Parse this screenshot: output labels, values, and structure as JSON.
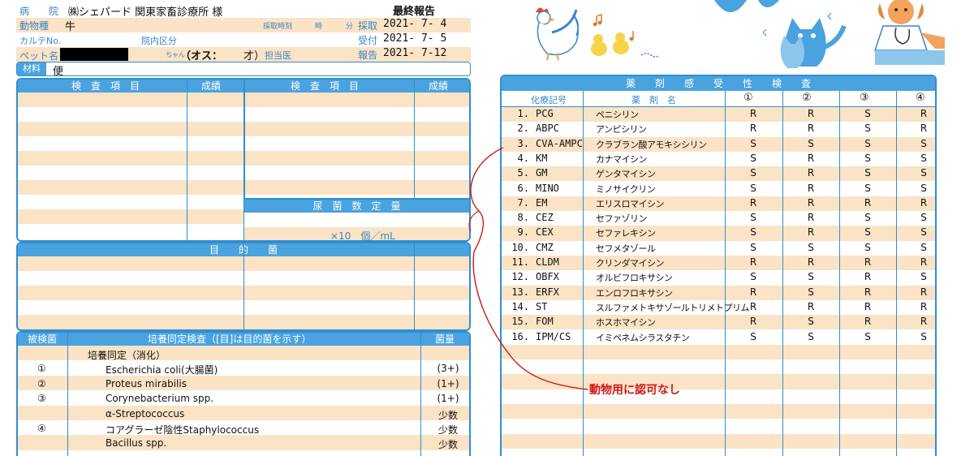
{
  "header": {
    "hospital_label": "病　　院",
    "hospital_value": "㈱シェパード 関東家畜診療所 様",
    "report_title": "最終報告",
    "animal_label": "動物種",
    "animal_value": "牛",
    "collection_time_label": "採取時刻",
    "hour_label": "時",
    "minute_label": "分",
    "collect_label": "採取",
    "collect_date": "2021- 7- 4",
    "chart_label": "カルテNo.",
    "ward_label": "院内区分",
    "receive_label": "受付",
    "receive_date": "2021- 7- 5",
    "pet_label": "ペット名",
    "age_label": "ちゃん",
    "sex_value": "（オス：",
    "age_unit": "才）",
    "staff_label": "担当医",
    "report_label": "報告",
    "report_date": "2021- 7-12",
    "material_label": "材料",
    "material_value": "便"
  },
  "exam_box": {
    "col1": "検　査　項　目",
    "col2": "成績",
    "col3": "検　査　項　目",
    "col4": "成績",
    "urine_title": "尿　菌　数　定　量",
    "urine_unit": "×10　個／mL"
  },
  "target_box": {
    "title": "目　　的　　菌"
  },
  "culture": {
    "col1": "被検菌",
    "col2": "培養同定検査（[目]は目的菌を示す）",
    "col3": "菌量",
    "rows": [
      {
        "mark": "",
        "name": "培養同定（消化）",
        "amount": ""
      },
      {
        "mark": "①",
        "name": "Escherichia coli(大腸菌)",
        "amount": "(3+)"
      },
      {
        "mark": "②",
        "name": "Proteus mirabilis",
        "amount": "(1+)"
      },
      {
        "mark": "③",
        "name": "Corynebacterium spp.",
        "amount": "(1+)"
      },
      {
        "mark": "",
        "name": "α-Streptococcus",
        "amount": "少数"
      },
      {
        "mark": "④",
        "name": "コアグラーゼ陰性Staphylococcus",
        "amount": "少数"
      },
      {
        "mark": "",
        "name": "Bacillus spp.",
        "amount": "少数"
      }
    ]
  },
  "drug_table": {
    "title": "薬　　剤　　感　　受　　性　　検　　査",
    "col_code": "化療記号",
    "col_name": "薬　剤　名",
    "col_1": "①",
    "col_2": "②",
    "col_3": "③",
    "col_4": "④",
    "rows": [
      {
        "no": "1.",
        "code": "PCG",
        "name": "ペニシリン",
        "r1": "R",
        "r2": "R",
        "r3": "S",
        "r4": "R"
      },
      {
        "no": "2.",
        "code": "ABPC",
        "name": "アンピシリン",
        "r1": "R",
        "r2": "R",
        "r3": "S",
        "r4": "R"
      },
      {
        "no": "3.",
        "code": "CVA-AMPC",
        "name": "クラブラン酸アモキシシリン",
        "r1": "S",
        "r2": "S",
        "r3": "S",
        "r4": "S"
      },
      {
        "no": "4.",
        "code": "KM",
        "name": "カナマイシン",
        "r1": "S",
        "r2": "R",
        "r3": "S",
        "r4": "S"
      },
      {
        "no": "5.",
        "code": "GM",
        "name": "ゲンタマイシン",
        "r1": "S",
        "r2": "R",
        "r3": "S",
        "r4": "S"
      },
      {
        "no": "6.",
        "code": "MINO",
        "name": "ミノサイクリン",
        "r1": "S",
        "r2": "R",
        "r3": "S",
        "r4": "S"
      },
      {
        "no": "7.",
        "code": "EM",
        "name": "エリスロマイシン",
        "r1": "R",
        "r2": "R",
        "r3": "R",
        "r4": "R"
      },
      {
        "no": "8.",
        "code": "CEZ",
        "name": "セファゾリン",
        "r1": "S",
        "r2": "R",
        "r3": "S",
        "r4": "S"
      },
      {
        "no": "9.",
        "code": "CEX",
        "name": "セファレキシン",
        "r1": "S",
        "r2": "R",
        "r3": "S",
        "r4": "S"
      },
      {
        "no": "10.",
        "code": "CMZ",
        "name": "セフメタゾール",
        "r1": "S",
        "r2": "S",
        "r3": "S",
        "r4": "S"
      },
      {
        "no": "11.",
        "code": "CLDM",
        "name": "クリンダマイシン",
        "r1": "R",
        "r2": "R",
        "r3": "R",
        "r4": "R"
      },
      {
        "no": "12.",
        "code": "OBFX",
        "name": "オルビフロキサシン",
        "r1": "S",
        "r2": "S",
        "r3": "R",
        "r4": "S"
      },
      {
        "no": "13.",
        "code": "ERFX",
        "name": "エンロフロキサシン",
        "r1": "R",
        "r2": "S",
        "r3": "R",
        "r4": "R"
      },
      {
        "no": "14.",
        "code": "ST",
        "name": "スルファメトキサゾールトリメトプリム",
        "r1": "R",
        "r2": "R",
        "r3": "R",
        "r4": "R"
      },
      {
        "no": "15.",
        "code": "FOM",
        "name": "ホスホマイシン",
        "r1": "R",
        "r2": "S",
        "r3": "R",
        "r4": "R"
      },
      {
        "no": "16.",
        "code": "IPM/CS",
        "name": "イミペネムシラスタチン",
        "r1": "S",
        "r2": "S",
        "r3": "S",
        "r4": "S"
      }
    ]
  },
  "annotation": "動物用に認可なし",
  "colors": {
    "accent_blue": "#2f8fd0",
    "stripe": "#fbe3c6",
    "note_red": "#d01818"
  },
  "icons": [
    "rooster-icon",
    "chicks-icon",
    "music-notes-icon",
    "cats-icon",
    "doctor-dog-icon"
  ]
}
